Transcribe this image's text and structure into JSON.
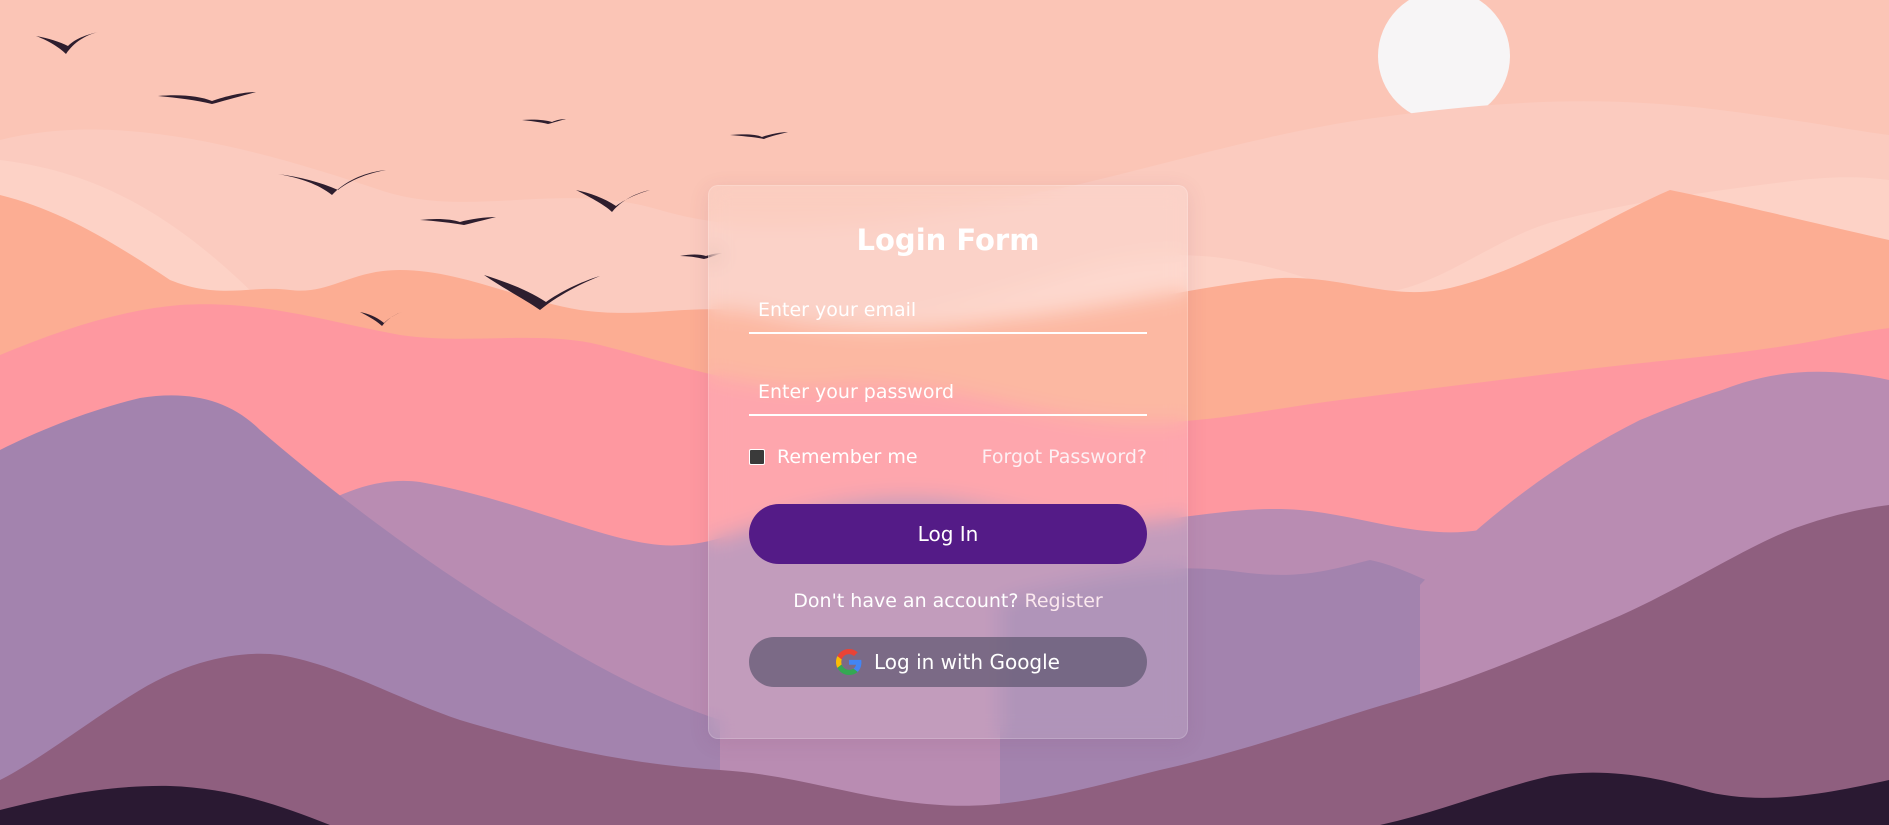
{
  "form": {
    "title": "Login Form",
    "email_placeholder": "Enter your email",
    "password_placeholder": "Enter your password",
    "remember_label": "Remember me",
    "forgot_link": "Forgot Password?",
    "login_button": "Log In",
    "register_prompt": "Don't have an account?",
    "register_link": "Register",
    "google_button": "Log in with Google"
  },
  "icons": {
    "google": "google-icon",
    "sun": "sun",
    "birds": "bird-silhouettes"
  },
  "colors": {
    "sky": "#fbc5b6",
    "sun": "#f7f5f6",
    "button_primary": "#541b87",
    "button_google": "#5f5870",
    "mountain_far": "#fbc9bd",
    "mountain_peach": "#fcad93",
    "mountain_pink": "#fe98a0",
    "mountain_mauve": "#b98cb2",
    "mountain_lavender": "#a383ae",
    "mountain_plum": "#8f5f7f",
    "mountain_dark": "#2a1932",
    "bird": "#2e1e2e"
  }
}
